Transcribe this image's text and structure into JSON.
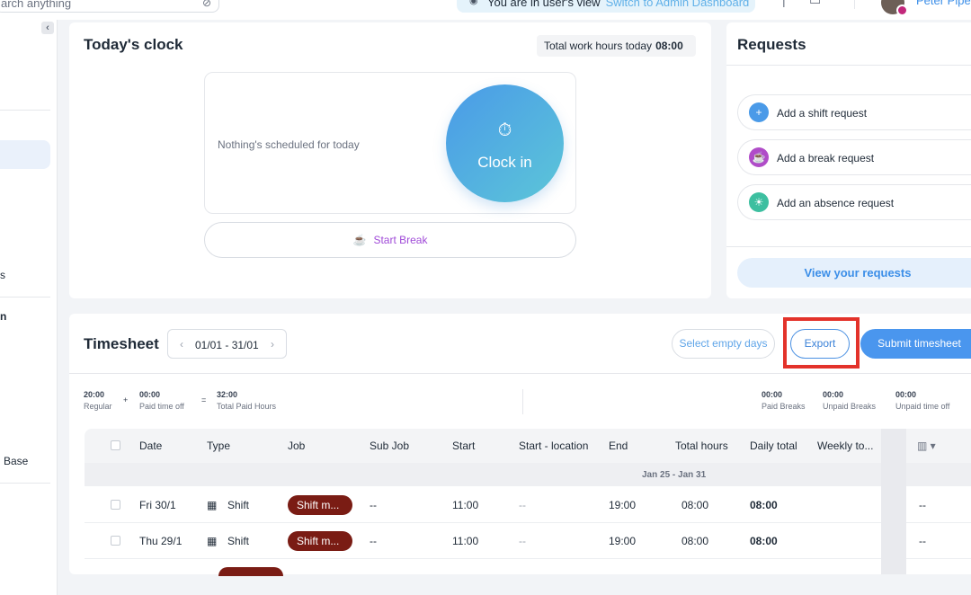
{
  "topbar": {
    "search_placeholder": "arch anything",
    "banner_text": "You are in user's view",
    "banner_link": "Switch to Admin Dashboard",
    "user_name": "Peter Piper"
  },
  "sidebar": {
    "collapse_glyph": "‹",
    "fragments": [
      "s",
      "n",
      "Base"
    ]
  },
  "clock": {
    "title": "Today's clock",
    "total_label": "Total work hours today",
    "total_value": "08:00",
    "nothing_text": "Nothing's scheduled for today",
    "clock_in_label": "Clock in",
    "start_break_label": "Start Break"
  },
  "requests": {
    "title": "Requests",
    "items": [
      {
        "label": "Add a shift request",
        "icon": "plus-icon",
        "color": "#4a9ae8"
      },
      {
        "label": "Add a break request",
        "icon": "coffee-icon",
        "color": "#b04cc8"
      },
      {
        "label": "Add an absence request",
        "icon": "sun-icon",
        "color": "#3dbfa0"
      }
    ],
    "view_label": "View your requests"
  },
  "timesheet": {
    "title": "Timesheet",
    "range": "01/01 - 31/01",
    "select_empty_label": "Select empty days",
    "export_label": "Export",
    "submit_label": "Submit timesheet",
    "summary": {
      "regular_value": "20:00",
      "regular_label": "Regular",
      "pto_value": "00:00",
      "pto_label": "Paid time off",
      "total_value": "32:00",
      "total_label": "Total Paid Hours",
      "paid_breaks_value": "00:00",
      "paid_breaks_label": "Paid Breaks",
      "unpaid_breaks_value": "00:00",
      "unpaid_breaks_label": "Unpaid Breaks",
      "unpaid_to_value": "00:00",
      "unpaid_to_label": "Unpaid time off"
    },
    "columns": [
      "Date",
      "Type",
      "Job",
      "Sub Job",
      "Start",
      "Start - location",
      "End",
      "Total hours",
      "Daily total",
      "Weekly to..."
    ],
    "group_label": "Jan 25 - Jan 31",
    "rows": [
      {
        "date": "Fri 30/1",
        "type": "Shift",
        "job": "Shift m...",
        "sub_job": "--",
        "start": "11:00",
        "start_location": "--",
        "end": "19:00",
        "total_hours": "08:00",
        "daily_total": "08:00",
        "extra": "--"
      },
      {
        "date": "Thu 29/1",
        "type": "Shift",
        "job": "Shift m...",
        "sub_job": "--",
        "start": "11:00",
        "start_location": "--",
        "end": "19:00",
        "total_hours": "08:00",
        "daily_total": "08:00",
        "extra": "--"
      }
    ]
  },
  "colors": {
    "accent": "#4a96ee",
    "job_pill": "#7a1c14",
    "highlight": "#e3322a"
  }
}
